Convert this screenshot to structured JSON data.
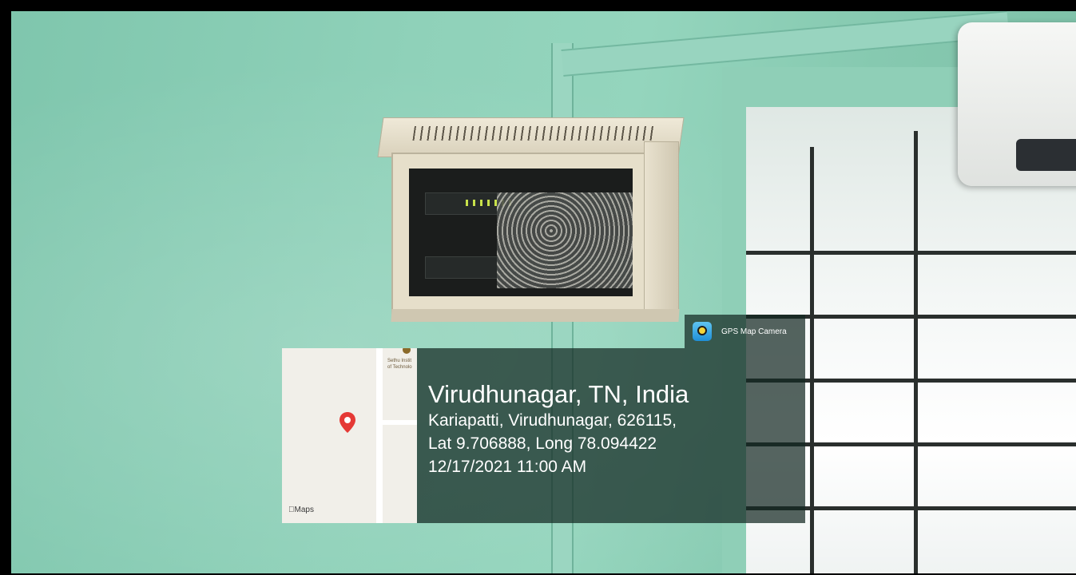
{
  "overlay": {
    "app_name": "GPS Map Camera",
    "location_title": "Virudhunagar, TN, India",
    "address": "Kariapatti, Virudhunagar, 626115,",
    "coordinates": "Lat 9.706888, Long 78.094422",
    "datetime": "12/17/2021 11:00 AM"
  },
  "map": {
    "provider_label": "Maps",
    "poi_label_line1": "Sethu Instit",
    "poi_label_line2": "of Technolo",
    "pin_icon": "location-pin-icon",
    "pin_color": "#e53935"
  },
  "colors": {
    "wall": "#8fd1b9",
    "overlay_bg": "#14281f"
  }
}
